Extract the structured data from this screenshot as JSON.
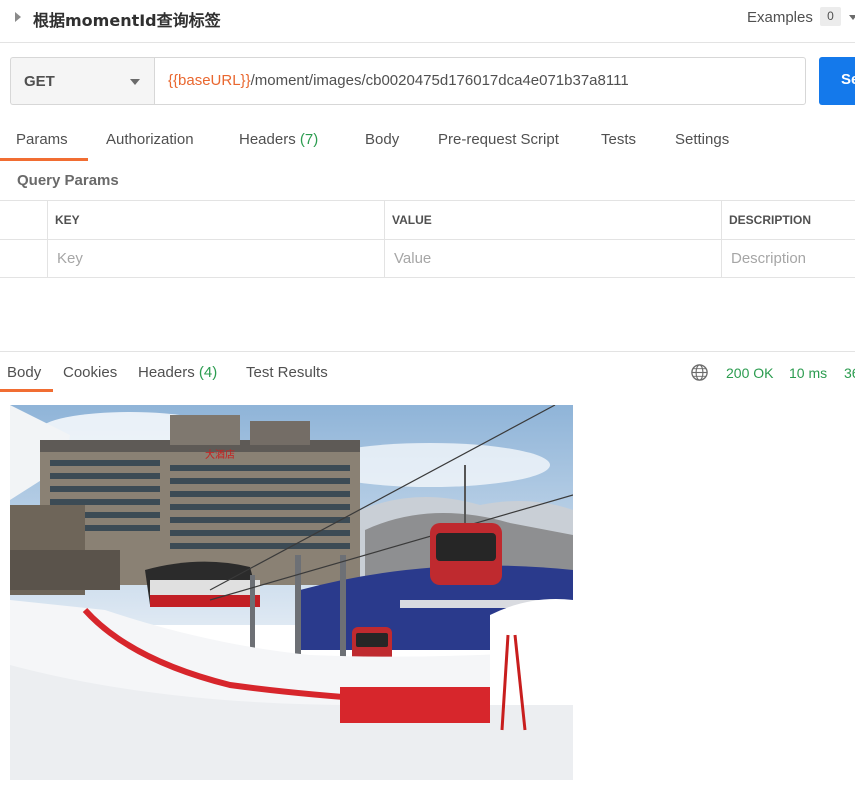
{
  "request": {
    "title": "根据momentId查询标签",
    "examples_label": "Examples",
    "examples_count": "0",
    "method": "GET",
    "url_variable": "{{baseURL}}",
    "url_path": "/moment/images/cb0020475d176017dca4e071b37a8111",
    "send_label": "Se"
  },
  "request_tabs": [
    {
      "label": "Params",
      "count": ""
    },
    {
      "label": "Authorization",
      "count": ""
    },
    {
      "label": "Headers",
      "count": "(7)"
    },
    {
      "label": "Body",
      "count": ""
    },
    {
      "label": "Pre-request Script",
      "count": ""
    },
    {
      "label": "Tests",
      "count": ""
    },
    {
      "label": "Settings",
      "count": ""
    }
  ],
  "query_params": {
    "title": "Query Params",
    "columns": [
      "KEY",
      "VALUE",
      "DESCRIPTION"
    ],
    "placeholders": [
      "Key",
      "Value",
      "Description"
    ]
  },
  "response_tabs": [
    {
      "label": "Body",
      "count": ""
    },
    {
      "label": "Cookies",
      "count": ""
    },
    {
      "label": "Headers",
      "count": "(4)"
    },
    {
      "label": "Test Results",
      "count": ""
    }
  ],
  "response_status": {
    "status": "200 OK",
    "time": "10 ms",
    "size": "36"
  },
  "colors": {
    "accent": "#f16d32",
    "send_button": "#1479eb",
    "success": "#2b9c4f",
    "url_variable": "#e9672f"
  },
  "icons": [
    "caret-right-icon",
    "chevron-down-icon",
    "globe-icon"
  ],
  "response_image_hotel_sign": "大酒店"
}
